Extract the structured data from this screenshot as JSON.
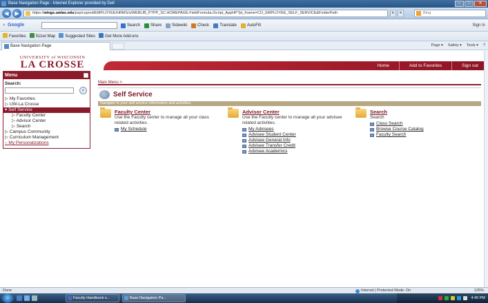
{
  "window": {
    "title": "Base Navigation Page - Internet Explorer provided by Dell",
    "controls": [
      "–",
      "□",
      "✕"
    ]
  },
  "address_bar": {
    "url_prefix": "https://",
    "url_domain": "wings.uwlax.edu",
    "url_rest": "/psp/csprod/EMPLOYEE/HRMS/s/WEBLIB_PTPP_SC.HOMEPAGE.FieldFormula.iScript_AppHP?pt_fname=CO_EMPLOYEE_SELF_SERVICE&FolderPath",
    "search_placeholder": "Bing"
  },
  "google_toolbar": {
    "close": "×",
    "logo": "Google",
    "items": [
      {
        "label": "Search",
        "icon": "search-icon",
        "color": "#3a6fd0"
      },
      {
        "label": "Share",
        "icon": "share-icon",
        "color": "#2c8f3d"
      },
      {
        "label": "Sidewiki",
        "icon": "sidewiki-icon",
        "color": "#8aa0c0"
      },
      {
        "label": "Check",
        "icon": "check-icon",
        "color": "#d07a20"
      },
      {
        "label": "Translate",
        "icon": "translate-icon",
        "color": "#4a78c8"
      },
      {
        "label": "AutoFill",
        "icon": "autofill-icon",
        "color": "#e0b030"
      }
    ],
    "signin": "Sign In"
  },
  "favorites_bar": {
    "items": [
      {
        "label": "Favorites",
        "color": "#e6b32f"
      },
      {
        "label": "511wi Map",
        "color": "#3f8f3f"
      },
      {
        "label": "Suggested Sites",
        "color": "#5a8fd6"
      },
      {
        "label": "Get More Add-ons",
        "color": "#3c75c4"
      }
    ]
  },
  "tab": {
    "label": "Base Navigation Page"
  },
  "command_bar": [
    "Page ▾",
    "Safety ▾",
    "Tools ▾",
    "?"
  ],
  "site": {
    "logo_line1": "UNIVERSITY of WISCONSIN",
    "logo_line2": "LA CROSSE",
    "top_nav": [
      "Home",
      "Add to Favorites",
      "Sign out"
    ]
  },
  "menu": {
    "title": "Menu",
    "search_label": "Search:",
    "search_button": "»",
    "items": [
      {
        "label": "My Favorites",
        "level": 0,
        "prefix": "▷ "
      },
      {
        "label": "UW-La Crosse",
        "level": 0,
        "prefix": "▷ "
      },
      {
        "label": "Self Service",
        "level": 0,
        "prefix": "▾ ",
        "selected": true
      },
      {
        "label": "Faculty Center",
        "level": 1,
        "prefix": "▷ "
      },
      {
        "label": "Advisor Center",
        "level": 1,
        "prefix": "▷ "
      },
      {
        "label": "Search",
        "level": 1,
        "prefix": "▷ "
      },
      {
        "label": "Campus Community",
        "level": 0,
        "prefix": "▷ "
      },
      {
        "label": "Curriculum Management",
        "level": 0,
        "prefix": "▷ "
      },
      {
        "label": "My Personalizations",
        "level": 0,
        "prefix": "– ",
        "personal": true
      }
    ]
  },
  "main": {
    "breadcrumb": "Main Menu >",
    "title": "Self Service",
    "band_text": "Navigate to your self service information and activities.",
    "sections": [
      {
        "title": "Faculty Center",
        "description": "Use the Faculty center to manage all your class related activities.",
        "links": [
          "My Schedule"
        ]
      },
      {
        "title": "Advisor Center",
        "description": "Use the Faculty center to manage all your advisee related activities.",
        "links": [
          "My Advisees",
          "Advisee Student Center",
          "Advisee General Info",
          "Advisee Transfer Credit",
          "Advisee Academics"
        ]
      },
      {
        "title": "Search",
        "description": "Search",
        "links": [
          "Class Search",
          "Browse Course Catalog",
          "Faculty Search"
        ]
      }
    ]
  },
  "status_bar": {
    "left": "Done",
    "zone": "Internet | Protected Mode: On",
    "zoom": "125%"
  },
  "taskbar": {
    "tasks": [
      "Faculty Handbook s...",
      "Base Navigation Pa..."
    ],
    "clock": "4:40 PM"
  }
}
